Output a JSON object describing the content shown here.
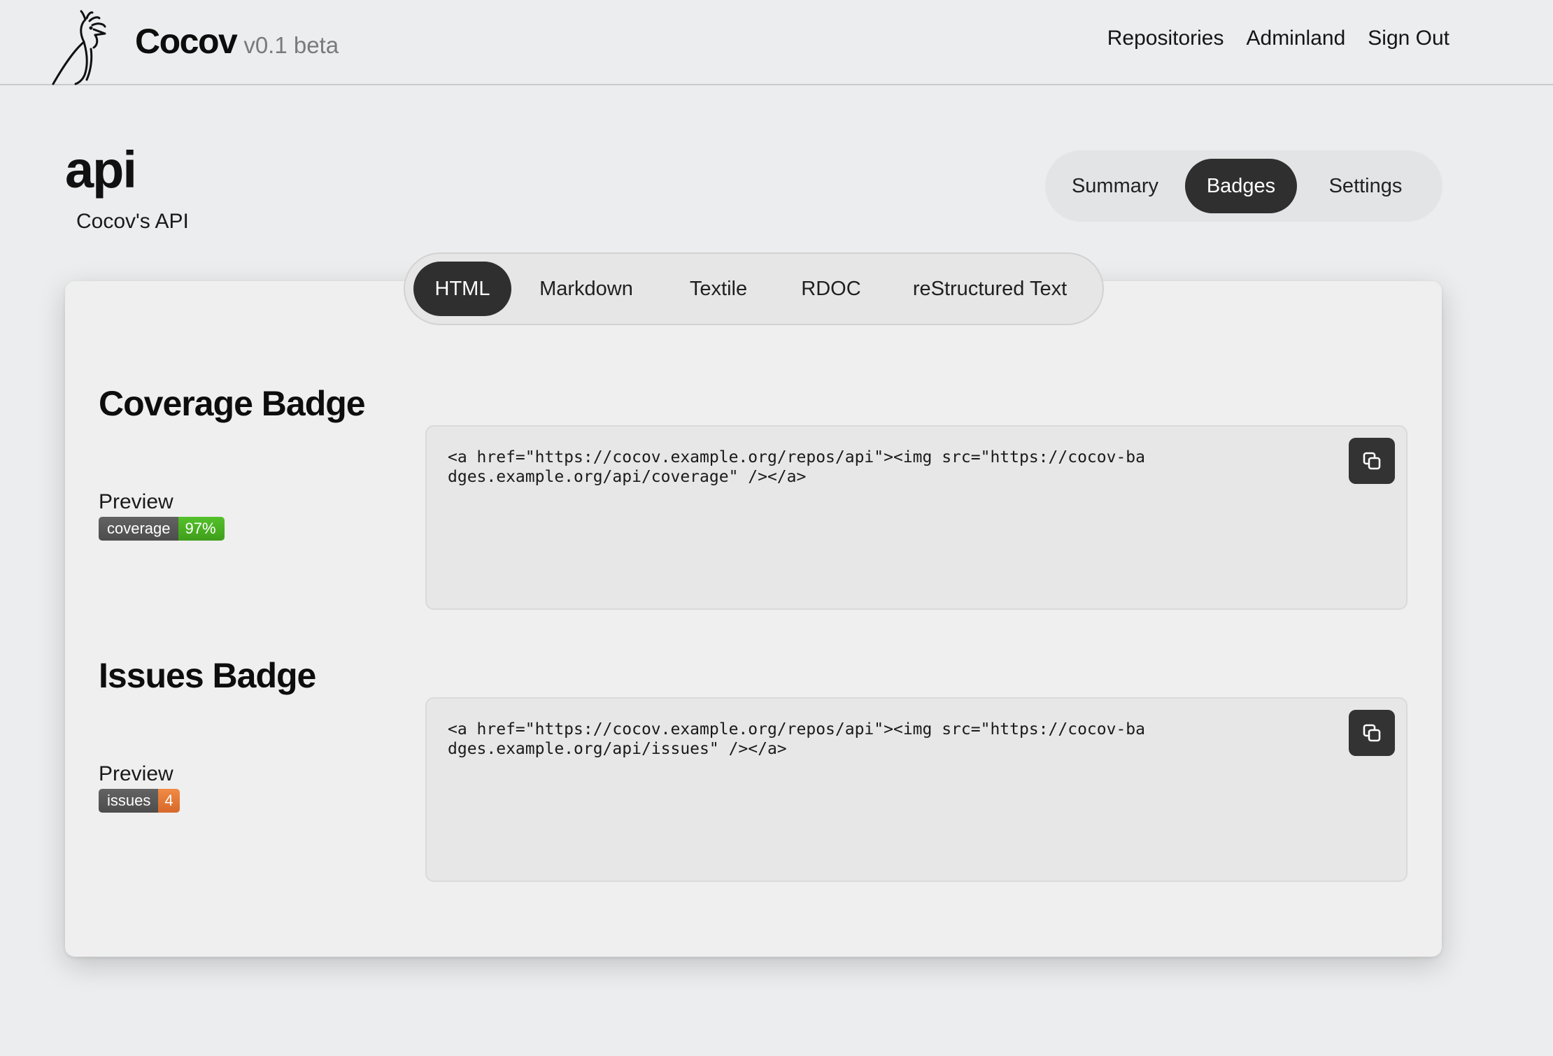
{
  "header": {
    "brand_name": "Cocov",
    "brand_version": "v0.1 beta",
    "nav": [
      "Repositories",
      "Adminland",
      "Sign Out"
    ]
  },
  "repo": {
    "name": "api",
    "description": "Cocov's API"
  },
  "repo_tabs": {
    "items": [
      "Summary",
      "Badges",
      "Settings"
    ],
    "active": "Badges"
  },
  "format_tabs": {
    "items": [
      "HTML",
      "Markdown",
      "Textile",
      "RDOC",
      "reStructured Text"
    ],
    "active": "HTML"
  },
  "badges": [
    {
      "title": "Coverage Badge",
      "preview_label": "Preview",
      "badge_label": "coverage",
      "badge_value": "97%",
      "badge_color": "#4cb421",
      "code": "<a href=\"https://cocov.example.org/repos/api\"><img src=\"https://cocov-badges.example.org/api/coverage\" /></a>"
    },
    {
      "title": "Issues Badge",
      "preview_label": "Preview",
      "badge_label": "issues",
      "badge_value": "4",
      "badge_color": "#e57a36",
      "code": "<a href=\"https://cocov.example.org/repos/api\"><img src=\"https://cocov-badges.example.org/api/issues\" /></a>"
    }
  ],
  "icons": {
    "logo": "rooster-logo",
    "copy": "copy-icon"
  }
}
